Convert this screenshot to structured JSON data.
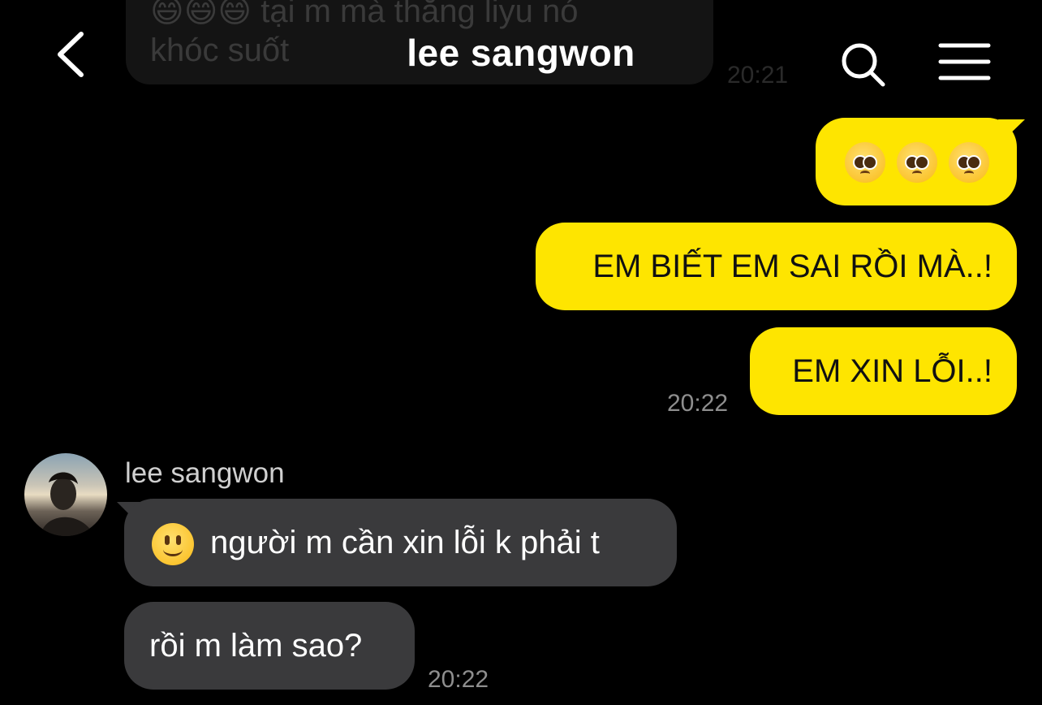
{
  "previous_message": {
    "text_line_1": "😄😄😄 tại m mà thằng liyu nó",
    "text_line_2": "khóc suốt",
    "time": "20:21"
  },
  "header": {
    "title": "lee sangwon",
    "back_icon": "chevron-left-icon",
    "search_icon": "search-icon",
    "menu_icon": "hamburger-menu-icon"
  },
  "outgoing": {
    "bubble_color": "#fee500",
    "messages": [
      {
        "emoji": "pleading-face",
        "count": 3
      },
      {
        "text": "EM BIẾT EM SAI RỒI MÀ..!"
      },
      {
        "text": "EM XIN LỖI..!"
      }
    ],
    "time": "20:22"
  },
  "incoming": {
    "bubble_color": "#3a3a3c",
    "sender": "lee sangwon",
    "avatar_icon": "avatar",
    "messages": [
      {
        "emoji": "slightly-smiling-face",
        "text": "người m cần xin lỗi k phải t"
      },
      {
        "text": "rồi m làm sao?"
      }
    ],
    "time": "20:22"
  }
}
